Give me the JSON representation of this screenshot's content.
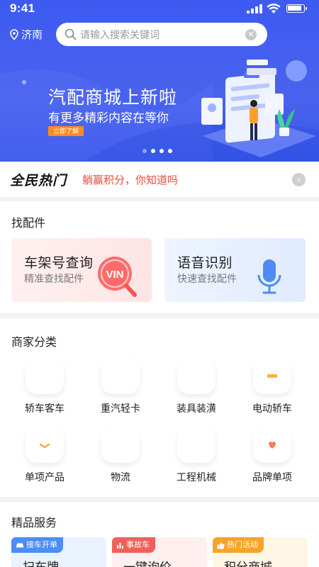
{
  "status": {
    "time": "9:41"
  },
  "header": {
    "city": "济南",
    "search_placeholder": "请输入搜索关键词"
  },
  "banner": {
    "title": "汽配商城上新啦",
    "subtitle": "有更多精彩内容在等你",
    "cta": "立即了解",
    "slide_count": 4,
    "active_slide": 1
  },
  "hot": {
    "logo": "全民热门",
    "text": "躺赢积分，你知道吗"
  },
  "parts": {
    "title": "找配件",
    "tiles": [
      {
        "title": "车架号查询",
        "subtitle": "精准查找配件",
        "badge": "VIN"
      },
      {
        "title": "语音识别",
        "subtitle": "快速查找配件"
      }
    ]
  },
  "categories": {
    "title": "商家分类",
    "items": [
      {
        "label": "轿车客车",
        "icon": "car-icon",
        "color": "#fb6f6f"
      },
      {
        "label": "重汽轻卡",
        "icon": "truck-icon",
        "color": "#fb8a4d"
      },
      {
        "label": "装具装潢",
        "icon": "car-sparkle-icon",
        "color": "#9b7cf5"
      },
      {
        "label": "电动轿车",
        "icon": "electric-car-icon",
        "color": "#fcb247"
      },
      {
        "label": "单项产品",
        "icon": "box-icon",
        "color": "#fb9a3c"
      },
      {
        "label": "物流",
        "icon": "delivery-truck-icon",
        "color": "#4d9bf6"
      },
      {
        "label": "工程机械",
        "icon": "robot-arm-icon",
        "color": "#f56a6a"
      },
      {
        "label": "品牌单项",
        "icon": "heart-badge-icon",
        "color": "#fb7a55"
      }
    ]
  },
  "services": {
    "title": "精品服务",
    "items": [
      {
        "tag": "接车开单",
        "name": "扫车牌",
        "tag_color": "#4c8df6",
        "bg": "#eaf2ff"
      },
      {
        "tag": "事故车",
        "name": "一键询价",
        "tag_color": "#f0605a",
        "bg": "#fff0ef"
      },
      {
        "tag": "热门活动",
        "name": "积分商城",
        "tag_color": "#f6a429",
        "bg": "#fff6e6"
      }
    ]
  }
}
